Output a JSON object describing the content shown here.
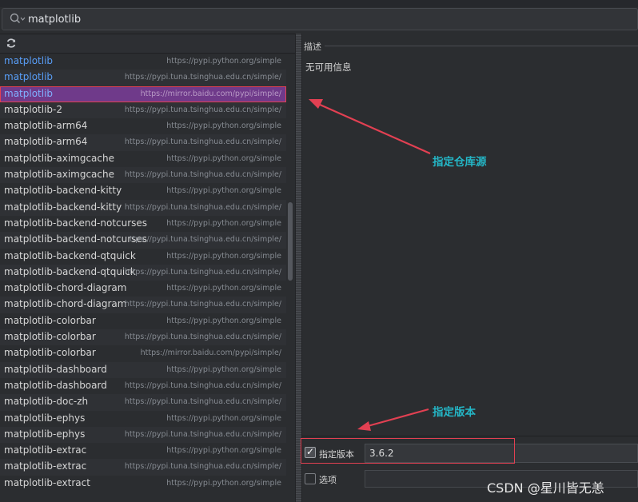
{
  "search": {
    "value": "matplotlib"
  },
  "description": {
    "label": "描述",
    "text": "无可用信息"
  },
  "packages": [
    {
      "name": "matplotlib",
      "source": "https://pypi.python.org/simple",
      "style": "blue"
    },
    {
      "name": "matplotlib",
      "source": "https://pypi.tuna.tsinghua.edu.cn/simple/",
      "style": "blue"
    },
    {
      "name": "matplotlib",
      "source": "https://mirror.baidu.com/pypi/simple/",
      "style": "selected"
    },
    {
      "name": "matplotlib-2",
      "source": "https://pypi.tuna.tsinghua.edu.cn/simple/",
      "style": ""
    },
    {
      "name": "matplotlib-arm64",
      "source": "https://pypi.python.org/simple",
      "style": ""
    },
    {
      "name": "matplotlib-arm64",
      "source": "https://pypi.tuna.tsinghua.edu.cn/simple/",
      "style": ""
    },
    {
      "name": "matplotlib-aximgcache",
      "source": "https://pypi.python.org/simple",
      "style": ""
    },
    {
      "name": "matplotlib-aximgcache",
      "source": "https://pypi.tuna.tsinghua.edu.cn/simple/",
      "style": ""
    },
    {
      "name": "matplotlib-backend-kitty",
      "source": "https://pypi.python.org/simple",
      "style": ""
    },
    {
      "name": "matplotlib-backend-kitty",
      "source": "https://pypi.tuna.tsinghua.edu.cn/simple/",
      "style": ""
    },
    {
      "name": "matplotlib-backend-notcurses",
      "source": "https://pypi.python.org/simple",
      "style": ""
    },
    {
      "name": "matplotlib-backend-notcurses",
      "source": "ttps://pypi.tuna.tsinghua.edu.cn/simple/",
      "style": ""
    },
    {
      "name": "matplotlib-backend-qtquick",
      "source": "https://pypi.python.org/simple",
      "style": ""
    },
    {
      "name": "matplotlib-backend-qtquick",
      "source": "https://pypi.tuna.tsinghua.edu.cn/simple/",
      "style": ""
    },
    {
      "name": "matplotlib-chord-diagram",
      "source": "https://pypi.python.org/simple",
      "style": ""
    },
    {
      "name": "matplotlib-chord-diagram",
      "source": "https://pypi.tuna.tsinghua.edu.cn/simple/",
      "style": ""
    },
    {
      "name": "matplotlib-colorbar",
      "source": "https://pypi.python.org/simple",
      "style": ""
    },
    {
      "name": "matplotlib-colorbar",
      "source": "https://pypi.tuna.tsinghua.edu.cn/simple/",
      "style": ""
    },
    {
      "name": "matplotlib-colorbar",
      "source": "https://mirror.baidu.com/pypi/simple/",
      "style": ""
    },
    {
      "name": "matplotlib-dashboard",
      "source": "https://pypi.python.org/simple",
      "style": ""
    },
    {
      "name": "matplotlib-dashboard",
      "source": "https://pypi.tuna.tsinghua.edu.cn/simple/",
      "style": ""
    },
    {
      "name": "matplotlib-doc-zh",
      "source": "https://pypi.tuna.tsinghua.edu.cn/simple/",
      "style": ""
    },
    {
      "name": "matplotlib-ephys",
      "source": "https://pypi.python.org/simple",
      "style": ""
    },
    {
      "name": "matplotlib-ephys",
      "source": "https://pypi.tuna.tsinghua.edu.cn/simple/",
      "style": ""
    },
    {
      "name": "matplotlib-extrac",
      "source": "https://pypi.python.org/simple",
      "style": ""
    },
    {
      "name": "matplotlib-extrac",
      "source": "https://pypi.tuna.tsinghua.edu.cn/simple/",
      "style": ""
    },
    {
      "name": "matplotlib-extract",
      "source": "https://pypi.python.org/simple",
      "style": ""
    }
  ],
  "options": {
    "version_label": "指定版本",
    "version_checked": true,
    "version_value": "3.6.2",
    "options_label": "选项",
    "options_checked": false,
    "options_value": ""
  },
  "annotations": {
    "repo_note": "指定仓库源",
    "version_note": "指定版本"
  },
  "watermark": "CSDN @星川皆无恙",
  "colors": {
    "accent_annotation": "#24b6c6",
    "arrow_red": "#e24052",
    "selection": "#6f3a8a"
  }
}
